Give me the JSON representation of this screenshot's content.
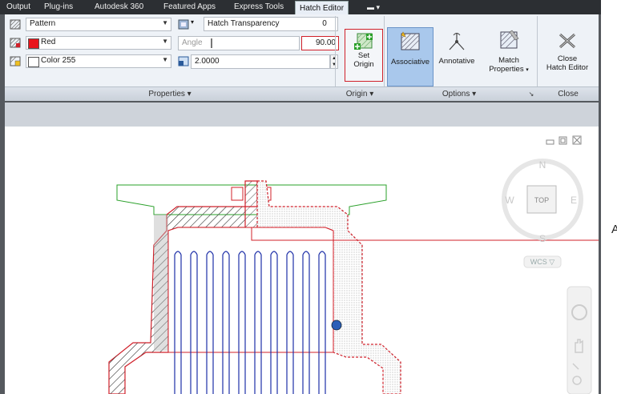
{
  "tabs": [
    "Output",
    "Plug-ins",
    "Autodesk 360",
    "Featured Apps",
    "Express Tools",
    "Hatch Editor"
  ],
  "properties": {
    "pattern_value": "Pattern",
    "color_value": "Red",
    "bgcolor_value": "Color 255",
    "transparency_label": "Hatch Transparency",
    "transparency_value": "0",
    "angle_label": "Angle",
    "angle_value": "90.00",
    "scale_value": "2.0000"
  },
  "buttons": {
    "set_origin_line1": "Set",
    "set_origin_line2": "Origin",
    "associative": "Associative",
    "annotative": "Annotative",
    "match_line1": "Match",
    "match_line2": "Properties",
    "close_line1": "Close",
    "close_line2": "Hatch Editor"
  },
  "panels": {
    "properties": "Properties ▾",
    "origin": "Origin ▾",
    "options": "Options ▾",
    "close": "Close"
  },
  "viewcube": {
    "north": "N",
    "south": "S",
    "east": "E",
    "west": "W",
    "top": "TOP",
    "wcs": "WCS ▽"
  },
  "callout_text": "A",
  "colors": {
    "accent_red": "#d0202a",
    "hatch_blue": "#1d2fa8",
    "ribbon_bg": "#eef2f7",
    "tab_active": "#e8eef6"
  }
}
